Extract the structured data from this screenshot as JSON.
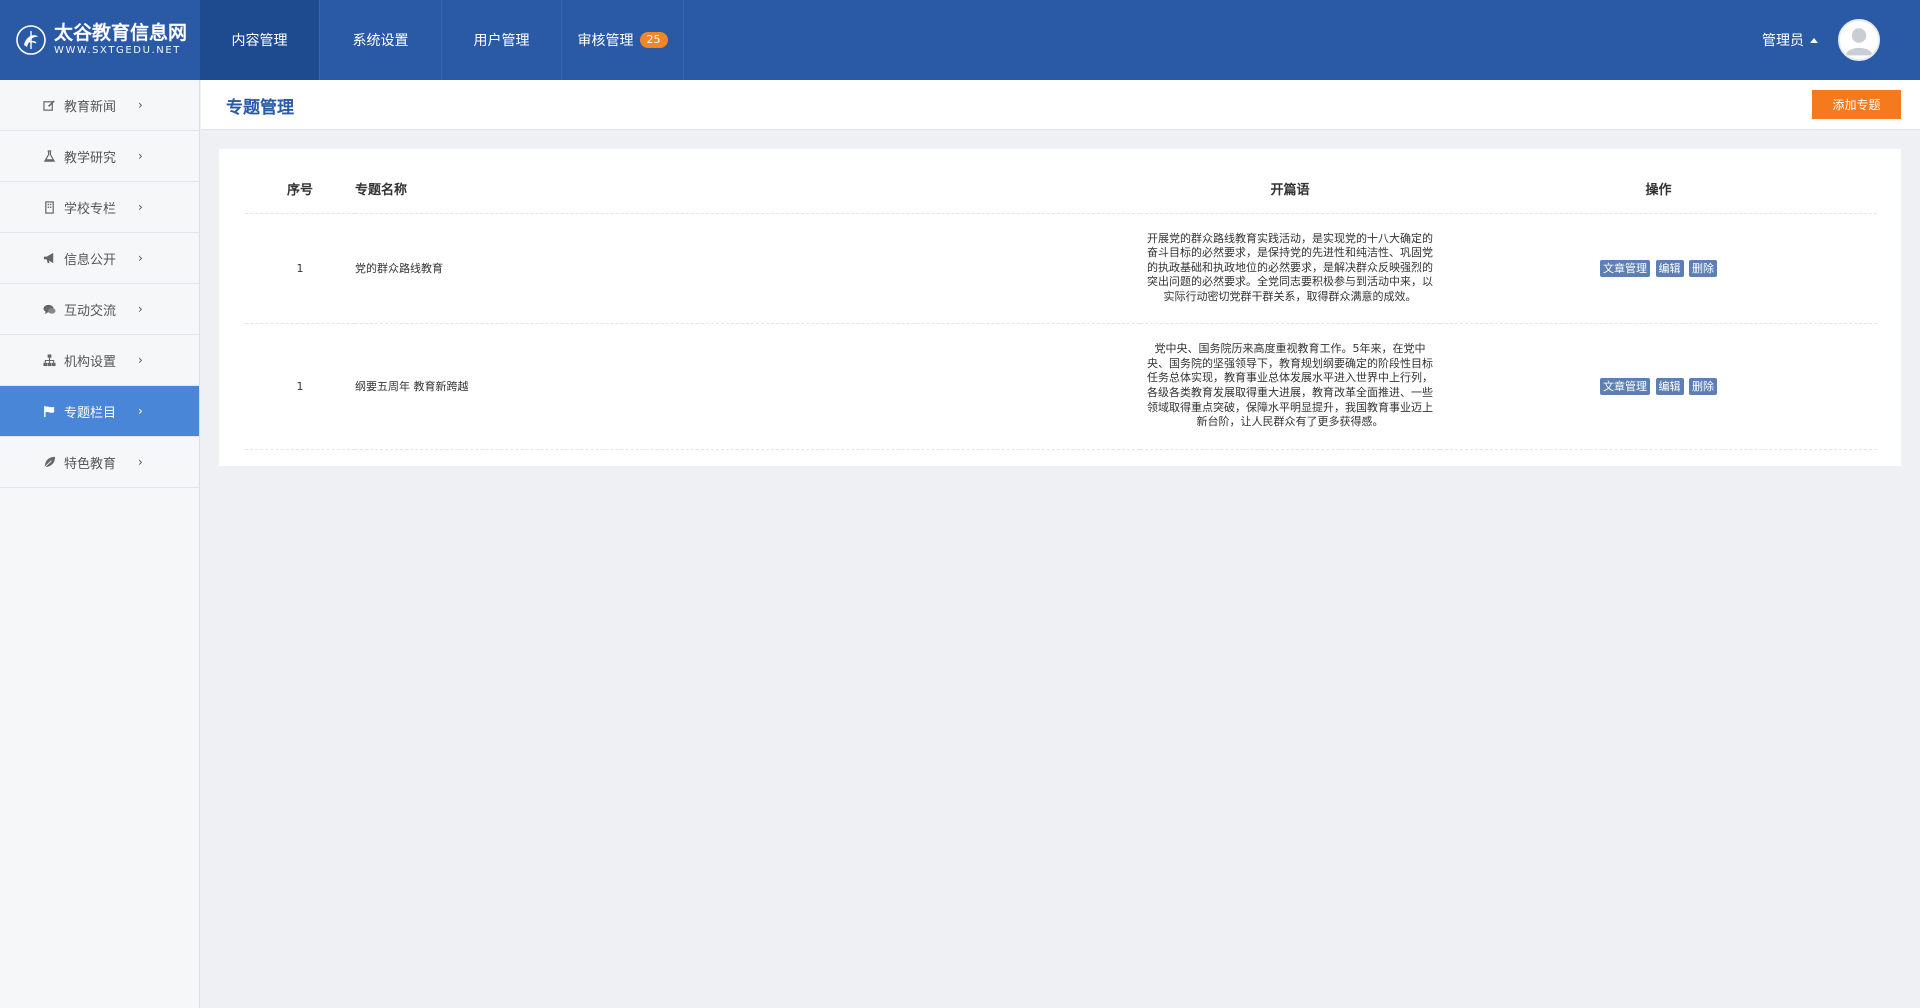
{
  "app": {
    "logo_title": "太谷教育信息网",
    "logo_sub": "WWW.SXTGEDU.NET"
  },
  "nav": {
    "items": [
      {
        "label": "内容管理",
        "active": true
      },
      {
        "label": "系统设置"
      },
      {
        "label": "用户管理"
      },
      {
        "label": "审核管理",
        "badge": "25"
      }
    ]
  },
  "user": {
    "name": "管理员"
  },
  "sidebar": {
    "items": [
      {
        "label": "教育新闻",
        "icon": "edit-icon"
      },
      {
        "label": "教学研究",
        "icon": "flask-icon"
      },
      {
        "label": "学校专栏",
        "icon": "building-icon"
      },
      {
        "label": "信息公开",
        "icon": "megaphone-icon"
      },
      {
        "label": "互动交流",
        "icon": "comments-icon"
      },
      {
        "label": "机构设置",
        "icon": "sitemap-icon"
      },
      {
        "label": "专题栏目",
        "icon": "flag-icon",
        "active": true
      },
      {
        "label": "特色教育",
        "icon": "leaf-icon"
      }
    ],
    "arrow": "›"
  },
  "page": {
    "title": "专题管理",
    "add_button": "添加专题"
  },
  "table": {
    "headers": {
      "no": "序号",
      "name": "专题名称",
      "opening": "开篇语",
      "ops": "操作"
    },
    "rows": [
      {
        "no": "1",
        "name": "党的群众路线教育",
        "opening": "开展党的群众路线教育实践活动，是实现党的十八大确定的奋斗目标的必然要求，是保持党的先进性和纯洁性、巩固党的执政基础和执政地位的必然要求，是解决群众反映强烈的突出问题的必然要求。全党同志要积极参与到活动中来，以实际行动密切党群干群关系，取得群众满意的成效。",
        "ops": [
          "文章管理",
          "编辑",
          "删除"
        ]
      },
      {
        "no": "1",
        "name": "纲要五周年 教育新跨越",
        "opening": "党中央、国务院历来高度重视教育工作。5年来，在党中央、国务院的坚强领导下，教育规划纲要确定的阶段性目标任务总体实现，教育事业总体发展水平进入世界中上行列，各级各类教育发展取得重大进展，教育改革全面推进、一些领域取得重点突破，保障水平明显提升，我国教育事业迈上新台阶，让人民群众有了更多获得感。",
        "ops": [
          "文章管理",
          "编辑",
          "删除"
        ]
      }
    ]
  },
  "colors": {
    "topbar": "#2a5aa6",
    "nav_active": "#1e4a8f",
    "sidebar_active": "#4a86d8",
    "accent_orange": "#f57a1d",
    "op_button": "#5d7fb3"
  }
}
